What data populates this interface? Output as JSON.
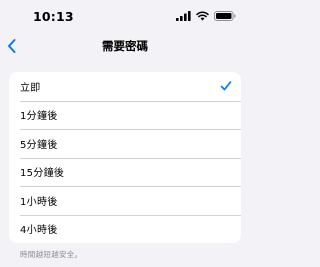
{
  "status_bar": {
    "time": "10:13",
    "icons": [
      "cellular-signal-icon",
      "wifi-icon",
      "battery-icon"
    ]
  },
  "nav": {
    "title": "需要密碼",
    "back_icon": "chevron-left-icon"
  },
  "options": [
    {
      "label": "立即",
      "selected": true
    },
    {
      "label": "1分鐘後",
      "selected": false
    },
    {
      "label": "5分鐘後",
      "selected": false
    },
    {
      "label": "15分鐘後",
      "selected": false
    },
    {
      "label": "1小時後",
      "selected": false
    },
    {
      "label": "4小時後",
      "selected": false
    }
  ],
  "footer": {
    "note": "時間越短越安全。"
  },
  "colors": {
    "accent": "#007aff",
    "background": "#f2f2f7",
    "card": "#ffffff",
    "footer_text": "#8a8a8e"
  }
}
